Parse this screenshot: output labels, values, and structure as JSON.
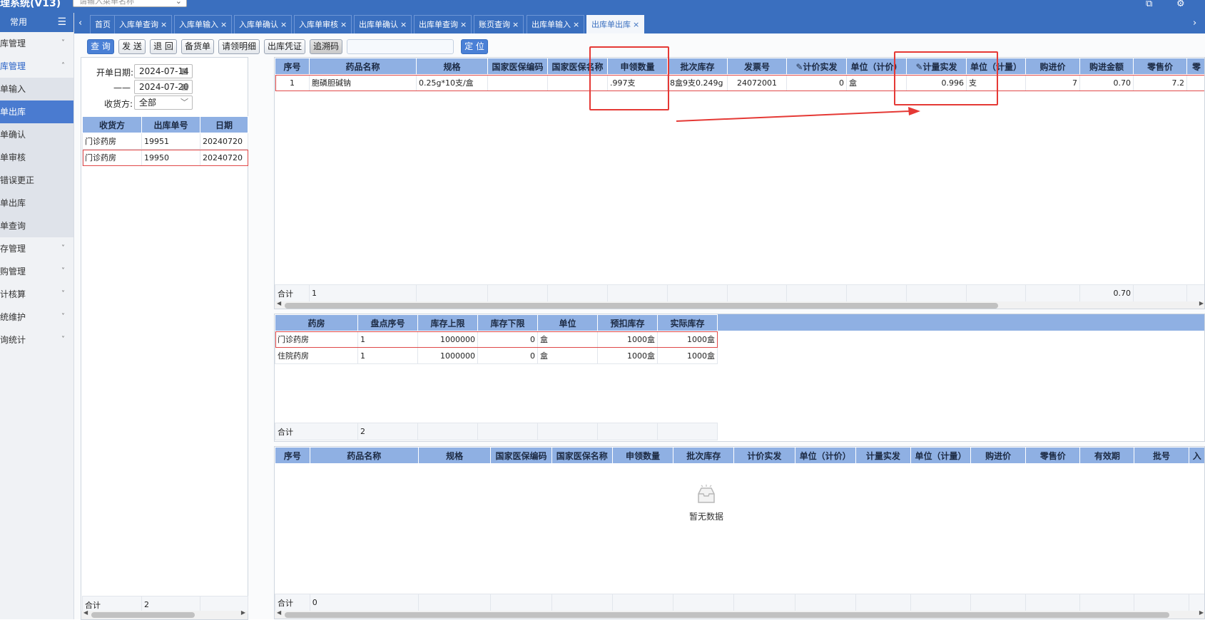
{
  "header": {
    "app_title": "理系统(V13)",
    "search_placeholder": "请输入菜单名称"
  },
  "sidebar": {
    "group_label": "常用",
    "items": [
      {
        "label": "库管理",
        "arrow": "˅"
      },
      {
        "label": "库管理",
        "arrow": "˄"
      },
      {
        "label": "单输入"
      },
      {
        "label": "单出库"
      },
      {
        "label": "单确认"
      },
      {
        "label": "单审核"
      },
      {
        "label": "错误更正"
      },
      {
        "label": "单出库"
      },
      {
        "label": "单查询"
      },
      {
        "label": "存管理",
        "arrow": "˅"
      },
      {
        "label": "购管理",
        "arrow": "˅"
      },
      {
        "label": "计核算",
        "arrow": "˅"
      },
      {
        "label": "统维护",
        "arrow": "˅"
      },
      {
        "label": "询统计",
        "arrow": "˅"
      }
    ]
  },
  "tabs": [
    {
      "label": "首页"
    },
    {
      "label": "入库单查询",
      "close": "×"
    },
    {
      "label": "入库单输入",
      "close": "×"
    },
    {
      "label": "入库单确认",
      "close": "×"
    },
    {
      "label": "入库单审核",
      "close": "×"
    },
    {
      "label": "出库单确认",
      "close": "×"
    },
    {
      "label": "出库单查询",
      "close": "×"
    },
    {
      "label": "账页查询",
      "close": "×"
    },
    {
      "label": "出库单输入",
      "close": "×"
    },
    {
      "label": "出库单出库",
      "close": "×"
    }
  ],
  "toolbar": {
    "query": "查 询",
    "send": "发 送",
    "return": "退 回",
    "prepare": "备货单",
    "request_detail": "请领明细",
    "voucher": "出库凭证",
    "trace": "追溯码",
    "locate": "定 位"
  },
  "filter": {
    "start_label": "开单日期:",
    "start_date": "2024-07-14",
    "range_dash": "——",
    "end_date": "2024-07-20",
    "receiver_label": "收货方:",
    "receiver_value": "全部"
  },
  "orders": {
    "headers": [
      "收货方",
      "出库单号",
      "日期"
    ],
    "rows": [
      [
        "门诊药房",
        "19951",
        "20240720"
      ],
      [
        "门诊药房",
        "19950",
        "20240720"
      ]
    ],
    "sum_label": "合计",
    "sum_value": "2"
  },
  "detail": {
    "headers": [
      "序号",
      "药品名称",
      "规格",
      "国家医保编码",
      "国家医保名称",
      "申领数量",
      "批次库存",
      "发票号",
      "计价实发",
      "单位（计价）",
      "计量实发",
      "单位（计量）",
      "购进价",
      "购进金额",
      "零售价",
      "零"
    ],
    "rows": [
      [
        "1",
        "胞磷胆碱钠",
        "0.25g*10支/盒",
        "",
        "",
        ".997支",
        "8盒9支0.249g",
        "24072001",
        "0",
        "盒",
        "0.996",
        "支",
        "7",
        "0.70",
        "7.2",
        ""
      ]
    ],
    "sum_label": "合计",
    "sum_value": "1",
    "sum_amount": "0.70"
  },
  "stock": {
    "headers": [
      "药房",
      "盘点序号",
      "库存上限",
      "库存下限",
      "单位",
      "预扣库存",
      "实际库存"
    ],
    "rows": [
      [
        "门诊药房",
        "1",
        "1000000",
        "0",
        "盒",
        "1000盒",
        "1000盒"
      ],
      [
        "住院药房",
        "1",
        "1000000",
        "0",
        "盒",
        "1000盒",
        "1000盒"
      ]
    ],
    "sum_label": "合计",
    "sum_value": "2"
  },
  "bottom": {
    "headers": [
      "序号",
      "药品名称",
      "规格",
      "国家医保编码",
      "国家医保名称",
      "申领数量",
      "批次库存",
      "计价实发",
      "单位（计价）",
      "计量实发",
      "单位（计量）",
      "购进价",
      "零售价",
      "有效期",
      "批号",
      "入"
    ],
    "empty_text": "暂无数据",
    "sum_label": "合计",
    "sum_value": "0"
  },
  "colors": {
    "brand": "#3a6fbf",
    "header_bg": "#8fb0e3",
    "highlight": "#e53935"
  },
  "icons": [
    "menu-icon",
    "calendar-icon",
    "chevron-down-icon",
    "edit-icon",
    "empty-inbox-icon",
    "close-icon"
  ]
}
